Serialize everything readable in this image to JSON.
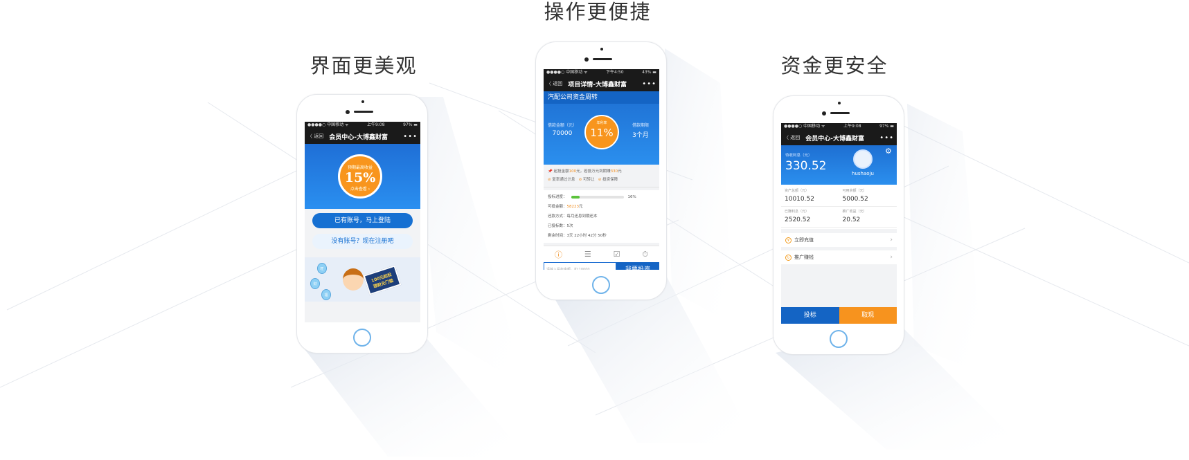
{
  "headings": {
    "left": "界面更美观",
    "center": "操作更便捷",
    "right": "资金更安全"
  },
  "phone1": {
    "status": {
      "carrier": "●●●●○ 中国移动 ᯤ",
      "time": "上午9:08",
      "battery": "97% ▬"
    },
    "nav": {
      "back": "〈 返回",
      "title": "会员中心-大博鑫财富",
      "more": "•••"
    },
    "banner": {
      "line1": "预期最高收益",
      "rate": "15%",
      "line3": "点击查看 ›"
    },
    "login_button": "已有账号，马上登陆",
    "register_button": "没有账号？现在注册吧",
    "promo": {
      "card": "100元起投\n理财无门槛",
      "balloons": [
        "旺",
        "财",
        "福"
      ]
    }
  },
  "phone2": {
    "status": {
      "carrier": "●●●●○ 中国移动 ᯤ",
      "time": "下午4:50",
      "battery": "43% ▬"
    },
    "nav": {
      "back": "〈 返回",
      "title": "项目详情-大博鑫财富",
      "more": "•••"
    },
    "project_name": "汽配公司资金周转",
    "loan_amount_label": "借款金额（元）",
    "loan_amount": "70000",
    "rate_label": "年利率",
    "rate": "11%",
    "term_label": "借款期限",
    "term": "3个月",
    "invest_tip_prefix": "起投金额",
    "invest_tip_min": "100",
    "invest_tip_mid": "元，若投万元到期赚",
    "invest_tip_earn": "330",
    "invest_tip_suffix": "元",
    "features": [
      "复率通过计息",
      "可转让",
      "投资保障"
    ],
    "progress_label": "投标进度：",
    "progress_value": 0.16,
    "progress_text": "16%",
    "available_label": "可投金额：",
    "available_value": "58223",
    "available_unit": "元",
    "repay_label": "还款方式：",
    "repay_value": "每月还息到期还本",
    "bids_label": "已投标数：",
    "bids_value": "5次",
    "remain_label": "剩余时间：",
    "remain_value": "3天 22小时 42分 50秒",
    "tab_icons": [
      "info-icon",
      "list-icon",
      "record-icon",
      "timer-icon"
    ],
    "input_placeholder": "请输入投标金额，如:10000",
    "invest_button": "我要投资"
  },
  "phone3": {
    "status": {
      "carrier": "●●●●○ 中国移动 ᯤ",
      "time": "上午9:08",
      "battery": "97% ▬"
    },
    "nav": {
      "back": "〈 返回",
      "title": "会员中心-大博鑫财富",
      "more": "•••"
    },
    "income_label": "待收利息（元）",
    "income_value": "330.52",
    "username": "hushaoju",
    "stats": [
      {
        "label": "资产总额（元）",
        "value": "10010.52"
      },
      {
        "label": "可用余额（元）",
        "value": "5000.52"
      },
      {
        "label": "已赚利息（元）",
        "value": "2520.52"
      },
      {
        "label": "推广收益（元）",
        "value": "20.52"
      }
    ],
    "recharge": "立即充值",
    "promote": "推广赚钱",
    "bid_button": "投标",
    "withdraw_button": "取现"
  }
}
